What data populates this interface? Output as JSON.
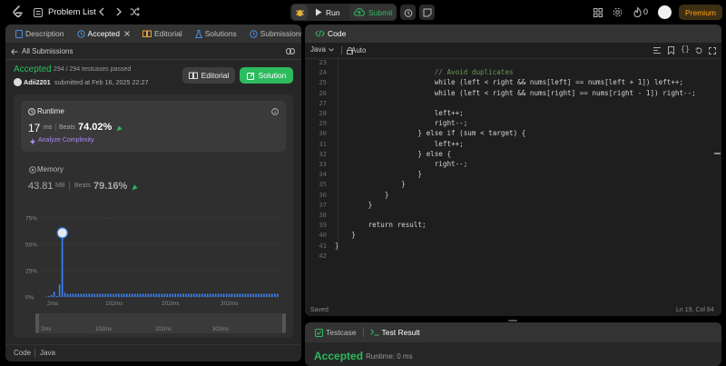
{
  "topbar": {
    "title": "Problem List",
    "run_label": "Run",
    "submit_label": "Submit",
    "streak_count": "0",
    "premium_label": "Premium"
  },
  "left_tabs": {
    "description": "Description",
    "accepted": "Accepted",
    "editorial": "Editorial",
    "solutions": "Solutions",
    "submissions": "Submissions"
  },
  "submission": {
    "back_label": "All Submissions",
    "status": "Accepted",
    "testcases": "294 / 294 testcases passed",
    "user": "Adii2201",
    "submitted_at": "submitted at Feb 16, 2025 22:27",
    "editorial_btn": "Editorial",
    "solution_btn": "Solution"
  },
  "runtime": {
    "label": "Runtime",
    "value": "17",
    "unit": "ms",
    "beats_label": "Beats",
    "beats_value": "74.02%",
    "analyze_label": "Analyze Complexity"
  },
  "memory": {
    "label": "Memory",
    "value": "43.81",
    "unit": "MB",
    "beats_label": "Beats",
    "beats_value": "79.16%"
  },
  "chart_data": {
    "type": "bar",
    "y_ticks": [
      "75%",
      "50%",
      "25%",
      "0%"
    ],
    "x_ticks": [
      "2ms",
      "102ms",
      "202ms",
      "302ms"
    ],
    "ylim": [
      0,
      75
    ],
    "values": [
      0.5,
      1,
      2,
      5,
      1,
      12,
      60,
      4,
      3,
      3,
      3,
      3,
      3,
      3,
      3,
      3,
      3,
      3,
      3,
      3,
      3,
      3,
      3,
      3,
      3,
      3,
      3,
      3,
      3,
      3,
      3,
      3,
      3,
      3,
      3,
      3,
      3,
      3,
      3,
      3,
      3,
      3,
      3,
      3,
      3,
      3,
      3,
      3,
      3,
      3,
      3,
      3,
      3,
      3,
      3,
      3,
      3,
      3,
      3,
      3,
      3,
      3,
      3,
      3,
      3,
      3,
      3,
      3,
      3,
      3,
      3,
      3,
      3,
      3,
      3,
      3,
      3,
      3,
      3,
      3,
      3,
      3,
      3,
      3,
      3,
      3,
      3
    ],
    "highlight_index": 6,
    "xlabel": "",
    "ylabel": "",
    "title": ""
  },
  "bottom_bar": {
    "code_label": "Code",
    "lang_label": "Java"
  },
  "code_panel": {
    "title": "Code",
    "lang": "Java",
    "auto_label": "Auto",
    "saved_label": "Saved",
    "cursor_pos": "Ln 19, Col 84",
    "lines": [
      {
        "n": "23",
        "t": ""
      },
      {
        "n": "24",
        "t": "                        // Avoid duplicates"
      },
      {
        "n": "25",
        "t": "                        while (left < right && nums[left] == nums[left + 1]) left++;"
      },
      {
        "n": "26",
        "t": "                        while (left < right && nums[right] == nums[right - 1]) right--;"
      },
      {
        "n": "27",
        "t": ""
      },
      {
        "n": "28",
        "t": "                        left++;"
      },
      {
        "n": "29",
        "t": "                        right--;"
      },
      {
        "n": "30",
        "t": "                    } else if (sum < target) {"
      },
      {
        "n": "31",
        "t": "                        left++;"
      },
      {
        "n": "32",
        "t": "                    } else {"
      },
      {
        "n": "33",
        "t": "                        right--;"
      },
      {
        "n": "34",
        "t": "                    }"
      },
      {
        "n": "35",
        "t": "                }"
      },
      {
        "n": "36",
        "t": "            }"
      },
      {
        "n": "37",
        "t": "        }"
      },
      {
        "n": "38",
        "t": ""
      },
      {
        "n": "39",
        "t": "        return result;"
      },
      {
        "n": "40",
        "t": "    }"
      },
      {
        "n": "41",
        "t": "}"
      },
      {
        "n": "42",
        "t": ""
      }
    ]
  },
  "test_panel": {
    "testcase_tab": "Testcase",
    "result_tab": "Test Result",
    "status": "Accepted",
    "runtime": "Runtime: 0 ms"
  },
  "colors": {
    "accent_green": "#2cbb5d",
    "blue_bar": "#3b82f6",
    "premium": "#ffa116"
  }
}
